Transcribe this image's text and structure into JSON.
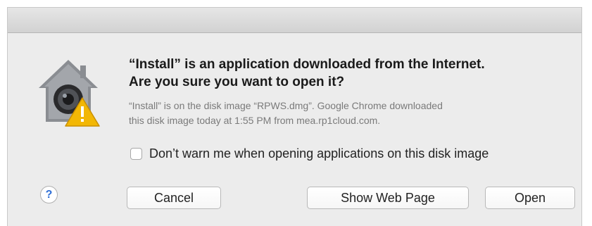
{
  "dialog": {
    "headline_line1": "“Install” is an application downloaded from the Internet.",
    "headline_line2": "Are you sure you want to open it?",
    "info_line1": "“Install” is on the disk image “RPWS.dmg”. Google Chrome downloaded",
    "info_line2": "this disk image today at 1:55 PM from mea.rp1cloud.com.",
    "checkbox_label": "Don’t warn me when opening applications on this disk image",
    "checkbox_checked": false,
    "icon": "gatekeeper-warning-icon"
  },
  "buttons": {
    "help": "?",
    "cancel": "Cancel",
    "show_web_page": "Show Web Page",
    "open": "Open"
  },
  "colors": {
    "help_accent": "#2f6fd6",
    "warning": "#f2b705"
  }
}
